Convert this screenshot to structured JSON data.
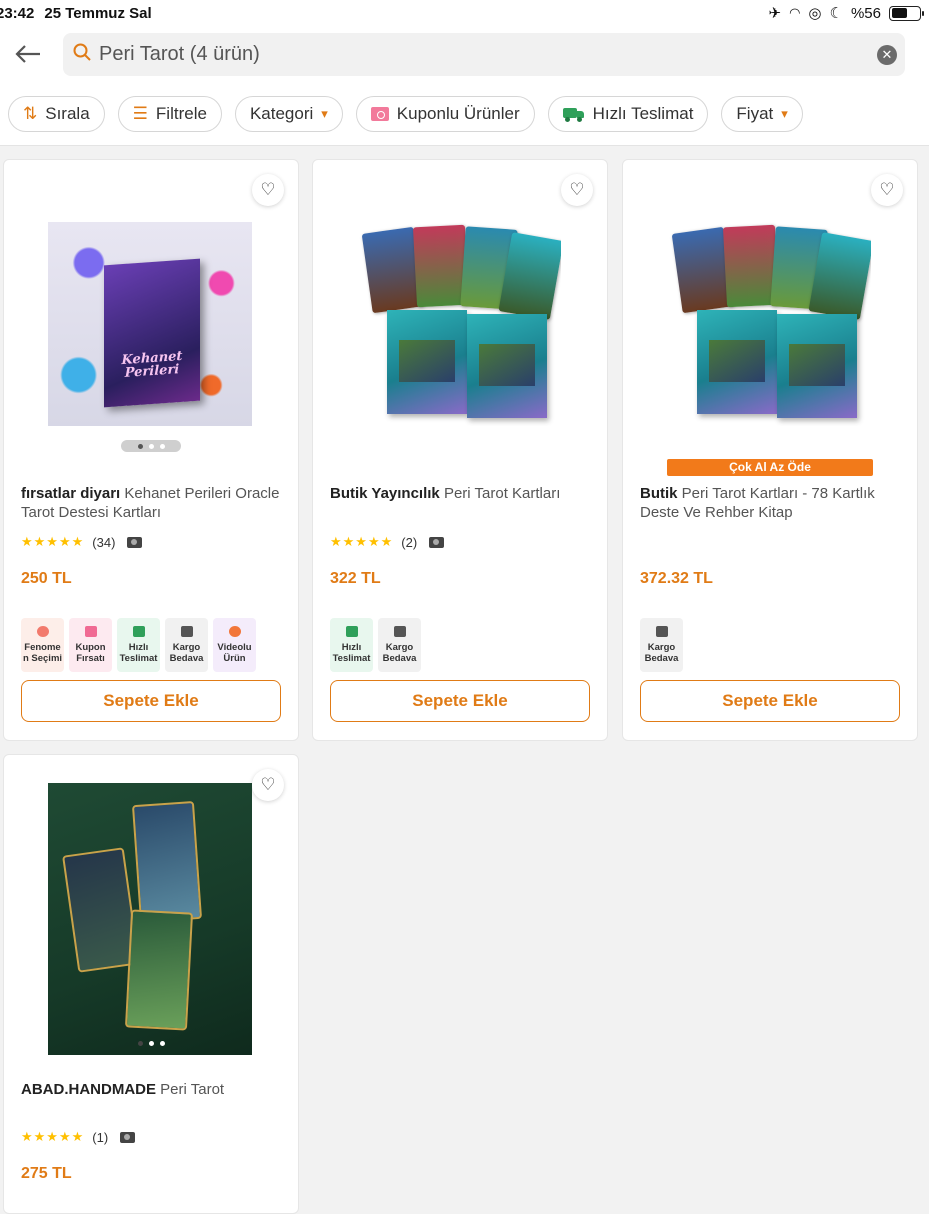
{
  "status": {
    "time": "23:42",
    "date": "25 Temmuz Sal",
    "battery": "%56"
  },
  "search": {
    "query": "Peri Tarot (4 ürün)"
  },
  "filters": [
    {
      "label": "Sırala"
    },
    {
      "label": "Filtrele"
    },
    {
      "label": "Kategori"
    },
    {
      "label": "Kuponlu Ürünler"
    },
    {
      "label": "Hızlı Teslimat"
    },
    {
      "label": "Fiyat"
    }
  ],
  "products": [
    {
      "brand": "fırsatlar diyarı",
      "name": "Kehanet Perileri Oracle Tarot Destesi Kartları",
      "review_count": "(34)",
      "price": "250 TL",
      "badges": [
        {
          "l1": "Fenome",
          "l2": "n Seçimi"
        },
        {
          "l1": "Kupon",
          "l2": "Fırsatı"
        },
        {
          "l1": "Hızlı",
          "l2": "Teslimat"
        },
        {
          "l1": "Kargo",
          "l2": "Bedava"
        },
        {
          "l1": "Videolu",
          "l2": "Ürün"
        }
      ],
      "cart_label": "Sepete Ekle",
      "cover_text": "Kehanet Perileri"
    },
    {
      "brand": "Butik Yayıncılık",
      "name": "Peri Tarot Kartları",
      "review_count": "(2)",
      "price": "322 TL",
      "badges": [
        {
          "l1": "Hızlı",
          "l2": "Teslimat"
        },
        {
          "l1": "Kargo",
          "l2": "Bedava"
        }
      ],
      "cart_label": "Sepete Ekle"
    },
    {
      "brand": "Butik",
      "name": "Peri Tarot Kartları - 78 Kartlık Deste Ve Rehber Kitap",
      "review_count": "",
      "price": "372.32 TL",
      "promo": "Çok Al Az Öde",
      "badges": [
        {
          "l1": "Kargo",
          "l2": "Bedava"
        }
      ],
      "cart_label": "Sepete Ekle"
    },
    {
      "brand": "ABAD.HANDMADE",
      "name": "Peri Tarot",
      "review_count": "(1)",
      "price": "275 TL"
    }
  ]
}
